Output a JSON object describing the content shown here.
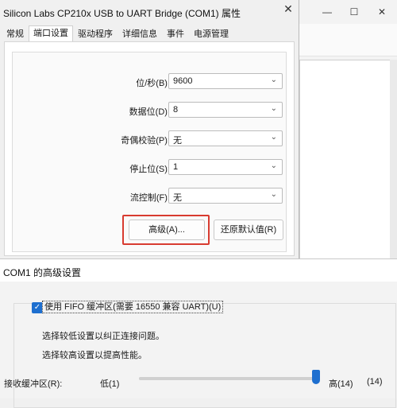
{
  "bg_window": {
    "controls": [
      "—",
      "☐",
      "✕"
    ]
  },
  "props": {
    "title": "Silicon Labs CP210x USB to UART Bridge (COM1) 属性",
    "tabs": [
      {
        "label": "常规"
      },
      {
        "label": "端口设置"
      },
      {
        "label": "驱动程序"
      },
      {
        "label": "详细信息"
      },
      {
        "label": "事件"
      },
      {
        "label": "电源管理"
      }
    ],
    "fields": [
      {
        "label": "位/秒(B):",
        "value": "9600"
      },
      {
        "label": "数据位(D):",
        "value": "8"
      },
      {
        "label": "奇偶校验(P):",
        "value": "无"
      },
      {
        "label": "停止位(S):",
        "value": "1"
      },
      {
        "label": "流控制(F):",
        "value": "无"
      }
    ],
    "advanced_label": "高级(A)...",
    "restore_label": "还原默认值(R)",
    "highlight_color": "#d83b30"
  },
  "advanced": {
    "title": "COM1 的高级设置",
    "fifo_label": "使用 FIFO 缓冲区(需要 16550 兼容 UART)(U)",
    "fifo_checked": true,
    "hint_low": "选择较低设置以纠正连接问题。",
    "hint_high": "选择较高设置以提高性能。",
    "receive_label": "接收缓冲区(R):",
    "low_label": "低(1)",
    "high_label": "高(14)",
    "current_value": "(14)",
    "slider_level": 14,
    "slider_max": 14
  }
}
